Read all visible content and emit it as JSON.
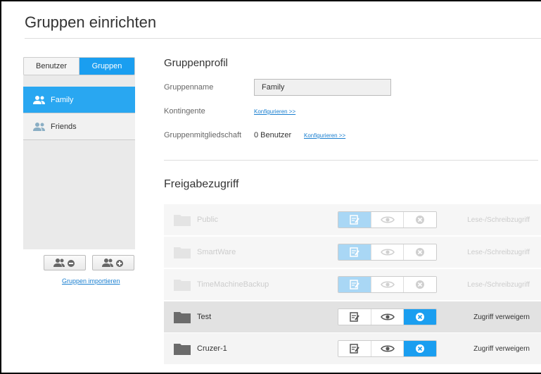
{
  "page": {
    "title": "Gruppen einrichten"
  },
  "sidebar": {
    "tabs": [
      {
        "label": "Benutzer"
      },
      {
        "label": "Gruppen"
      }
    ],
    "groups": [
      {
        "label": "Family"
      },
      {
        "label": "Friends"
      }
    ],
    "import_link": "Gruppen importieren"
  },
  "profile": {
    "heading": "Gruppenprofil",
    "name_label": "Gruppenname",
    "name_value": "Family",
    "quota_label": "Kontingente",
    "quota_link": "Konfigurieren >>",
    "membership_label": "Gruppenmitgliedschaft",
    "membership_value": "0 Benutzer",
    "membership_link": "Konfigurieren >>"
  },
  "shares": {
    "heading": "Freigabezugriff",
    "rows": [
      {
        "name": "Public",
        "status": "Lese-/Schreibzugriff",
        "selected_permission": "read-write"
      },
      {
        "name": "SmartWare",
        "status": "Lese-/Schreibzugriff",
        "selected_permission": "read-write"
      },
      {
        "name": "TimeMachineBackup",
        "status": "Lese-/Schreibzugriff",
        "selected_permission": "read-write"
      },
      {
        "name": "Test",
        "status": "Zugriff verweigern",
        "selected_permission": "deny"
      },
      {
        "name": "Cruzer-1",
        "status": "Zugriff verweigern",
        "selected_permission": "deny"
      }
    ]
  },
  "colors": {
    "accent": "#1a9ef0",
    "selected_group": "#29a7f1",
    "link": "#1a7fd0"
  },
  "icons": [
    "user-group-icon",
    "remove-group-icon",
    "add-group-icon",
    "folder-icon",
    "read-write-icon",
    "read-only-icon",
    "deny-icon"
  ]
}
